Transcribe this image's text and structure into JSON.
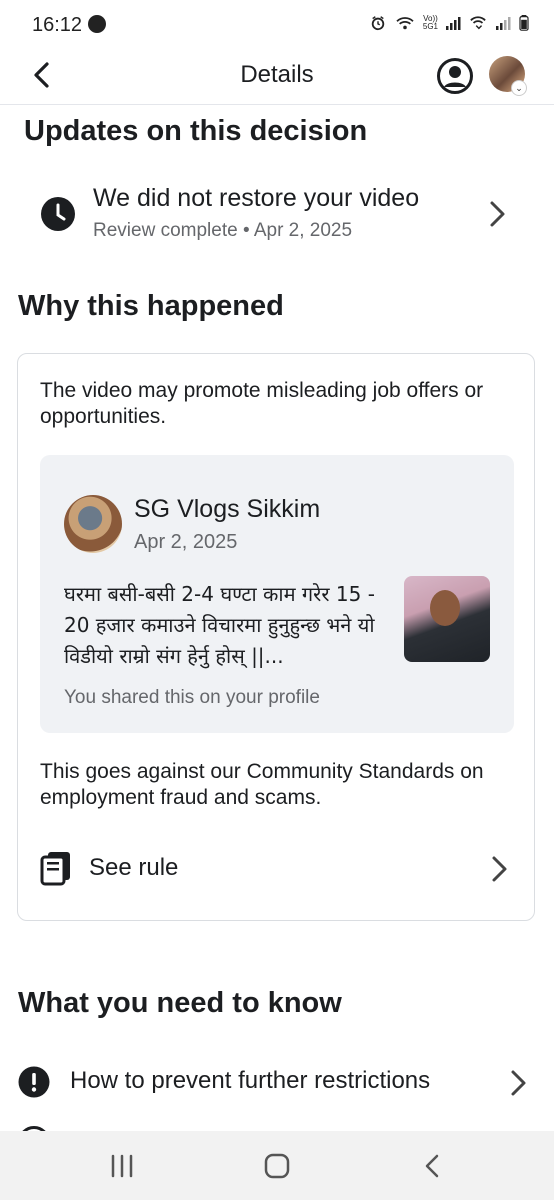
{
  "status_bar": {
    "time": "16:12",
    "indicators": [
      "alarm-icon",
      "wifi-icon",
      "volte-5g-icon",
      "signal-icon",
      "call-wifi-icon",
      "signal-icon",
      "battery-icon"
    ],
    "network_label_top": "Vo))",
    "network_label_bottom": "5G1"
  },
  "header": {
    "title": "Details",
    "back_icon": "back-arrow-icon",
    "profile_icon": "account-circle-icon"
  },
  "updates": {
    "heading": "Updates on this decision",
    "title": "We did not restore your video",
    "subtitle": "Review complete • Apr 2, 2025",
    "icon": "clock-icon"
  },
  "why": {
    "heading": "Why this happened",
    "reason": "The video may promote misleading job offers or opportunities.",
    "post": {
      "author": "SG Vlogs Sikkim",
      "date": "Apr 2, 2025",
      "text": "घरमा बसी-बसी 2-4 घण्टा काम गरेर  15 - 20 हजार कमाउने विचारमा हुनुहुन्छ भने यो विडीयो राम्रो संग हेर्नु होस् ||...",
      "shared_note": "You shared this on your profile"
    },
    "standards": "This goes against our Community Standards on employment fraud and scams.",
    "see_rule": "See rule"
  },
  "need": {
    "heading": "What you need to know",
    "item": "How to prevent further restrictions"
  },
  "nav": {
    "items": [
      "recent-apps-icon",
      "home-icon",
      "back-icon"
    ]
  }
}
